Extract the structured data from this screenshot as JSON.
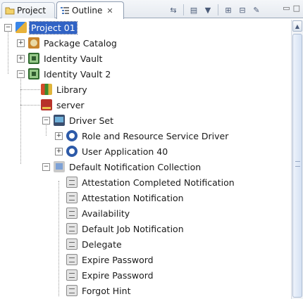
{
  "tabs": {
    "project": {
      "label": "Project",
      "icon": "folder-icon"
    },
    "outline": {
      "label": "Outline",
      "icon": "outline-icon",
      "close": "✕"
    }
  },
  "toolbar": {
    "buttons": [
      {
        "name": "link-with-editor-icon",
        "glyph": "⇆"
      },
      {
        "name": "new-item-icon",
        "glyph": "▤"
      },
      {
        "name": "filter-icon",
        "glyph": "▼"
      },
      {
        "name": "expand-all-icon",
        "glyph": "⊞"
      },
      {
        "name": "collapse-all-icon",
        "glyph": "⊟"
      },
      {
        "name": "wizard-icon",
        "glyph": "✎"
      }
    ],
    "minimize": "▭",
    "maximize": "□"
  },
  "tree": {
    "project": "Project 01",
    "package_catalog": "Package Catalog",
    "identity_vault": "Identity Vault",
    "identity_vault_2": "Identity Vault 2",
    "library": "Library",
    "server": "server",
    "driver_set": "Driver Set",
    "role_resource_driver": "Role and Resource Service Driver",
    "user_application": "User Application 40",
    "notification_collection": "Default Notification Collection",
    "notifications": [
      "Attestation Completed Notification",
      "Attestation Notification",
      "Availability",
      "Default Job Notification",
      "Delegate",
      "Expire Password",
      "Expire Password",
      "Forgot Hint"
    ]
  },
  "expanders": {
    "collapsed": "+",
    "expanded": "−"
  },
  "scrollbar": {
    "up_arrow": "▲"
  }
}
